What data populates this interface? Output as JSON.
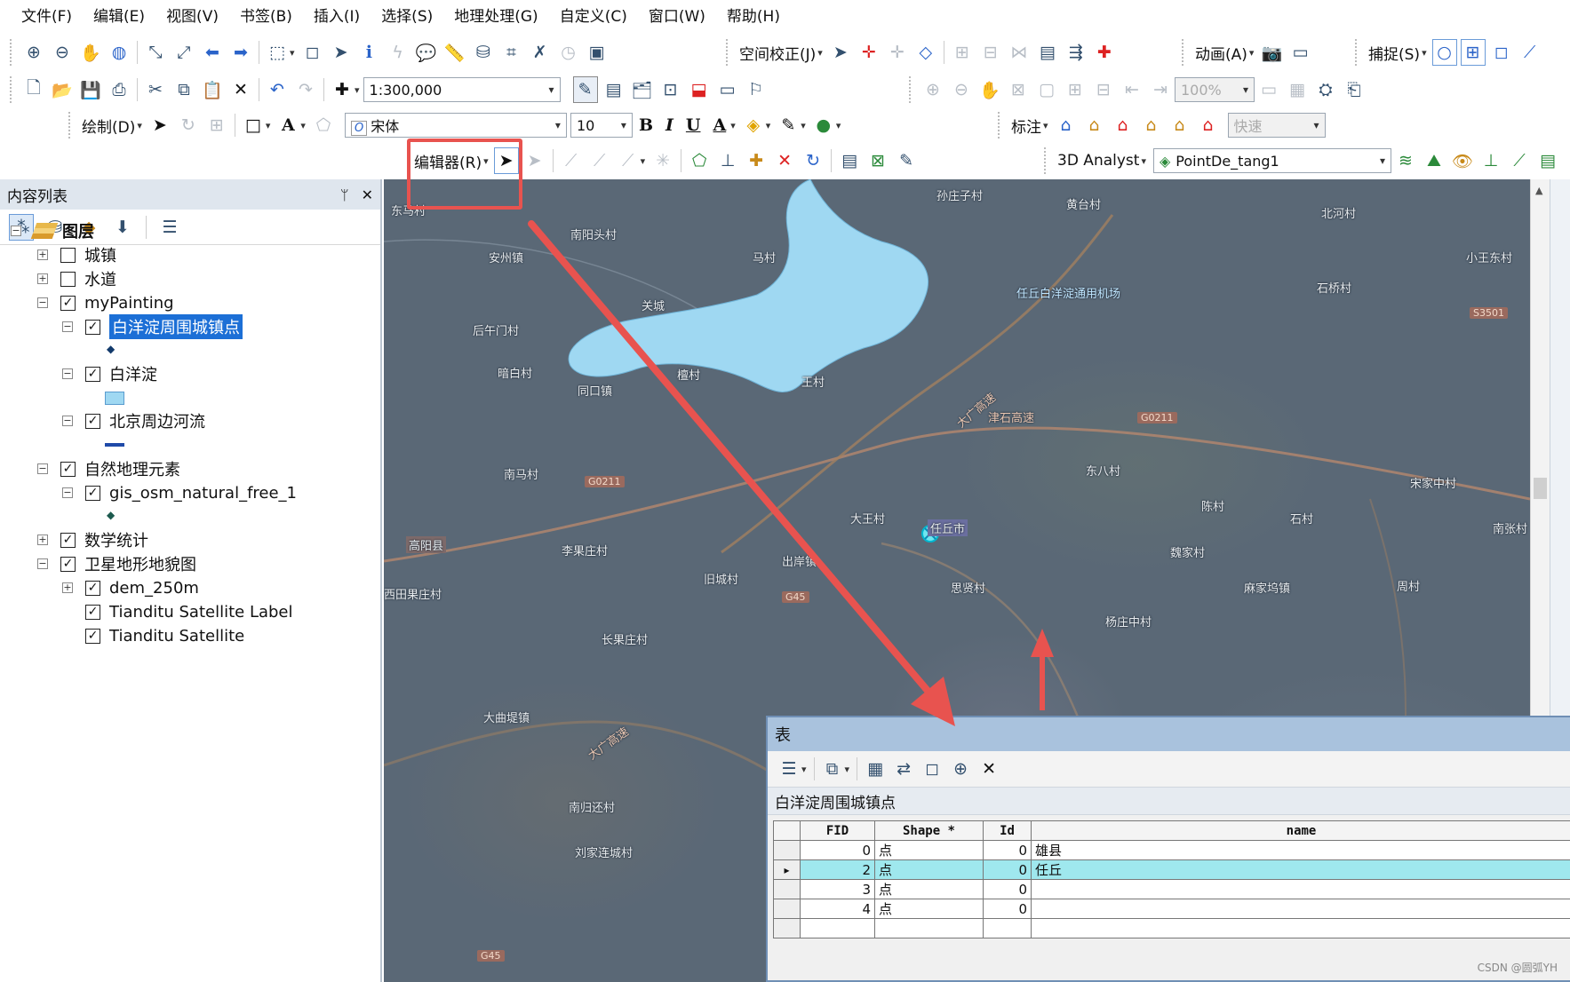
{
  "menubar": [
    "文件(F)",
    "编辑(E)",
    "视图(V)",
    "书签(B)",
    "插入(I)",
    "选择(S)",
    "地理处理(G)",
    "自定义(C)",
    "窗口(W)",
    "帮助(H)"
  ],
  "toolbars": {
    "spatial_adjust": "空间校正(J)",
    "animation": "动画(A)",
    "snapping": "捕捉(S)",
    "scale": "1:300,000",
    "draw": "绘制(D)",
    "font": "宋体",
    "font_size": "10",
    "bold": "B",
    "italic": "I",
    "underline": "U",
    "font_color_letter": "A",
    "labeling": "标注",
    "quick": "快速",
    "zoom_percent": "100%",
    "editor": "编辑器(R)",
    "analyst_3d": "3D Analyst",
    "layer_combo": "PointDe_tang1"
  },
  "toc": {
    "title": "内容列表",
    "pin": "ᛘ",
    "close": "✕",
    "root": "图层",
    "layers": {
      "chengzhen": "城镇",
      "shuidao": "水道",
      "mypainting": "myPainting",
      "baiyangdian_points": "白洋淀周围城镇点",
      "baiyangdian": "白洋淀",
      "beijing_rivers": "北京周边河流",
      "natural": "自然地理元素",
      "gis_osm": "gis_osm_natural_free_1",
      "stats": "数学统计",
      "satellite_group": "卫星地形地貌图",
      "dem": "dem_250m",
      "tdt_label": "Tianditu Satellite Label",
      "tdt_sat": "Tianditu Satellite"
    }
  },
  "map": {
    "labels": [
      "东马村",
      "安州镇",
      "南阳头村",
      "马村",
      "孙庄子村",
      "黄台村",
      "北河村",
      "小王东村",
      "任丘白洋淀通用机场",
      "石桥村",
      "后午门村",
      "关城",
      "暗白村",
      "同口镇",
      "檀村",
      "王村",
      "大广高速",
      "津石高速",
      "东八村",
      "南马村",
      "大王村",
      "高阳县",
      "李果庄村",
      "出岸镇",
      "旧城村",
      "任丘市",
      "陈村",
      "石村",
      "魏家村",
      "宋家中村",
      "南张村",
      "思贤村",
      "麻家坞镇",
      "周村",
      "杨庄中村",
      "长果庄村",
      "大曲堤镇",
      "南归还村",
      "刘家连城村",
      "西田果庄村",
      "大广高速"
    ],
    "shields": [
      "S3501",
      "G0211",
      "G0211",
      "G45",
      "G45"
    ]
  },
  "attr_table": {
    "window_title": "表",
    "table_name": "白洋淀周围城镇点",
    "columns": [
      "FID",
      "Shape *",
      "Id",
      "name"
    ],
    "rows": [
      {
        "marker": "",
        "fid": "0",
        "shape": "点",
        "id": "0",
        "name": "雄县"
      },
      {
        "marker": "▸",
        "fid": "2",
        "shape": "点",
        "id": "0",
        "name": "任丘"
      },
      {
        "marker": "",
        "fid": "3",
        "shape": "点",
        "id": "0",
        "name": ""
      },
      {
        "marker": "",
        "fid": "4",
        "shape": "点",
        "id": "0",
        "name": ""
      }
    ]
  },
  "annotation": {
    "color": "#e8534f"
  },
  "watermark": "CSDN @圆弧YH"
}
